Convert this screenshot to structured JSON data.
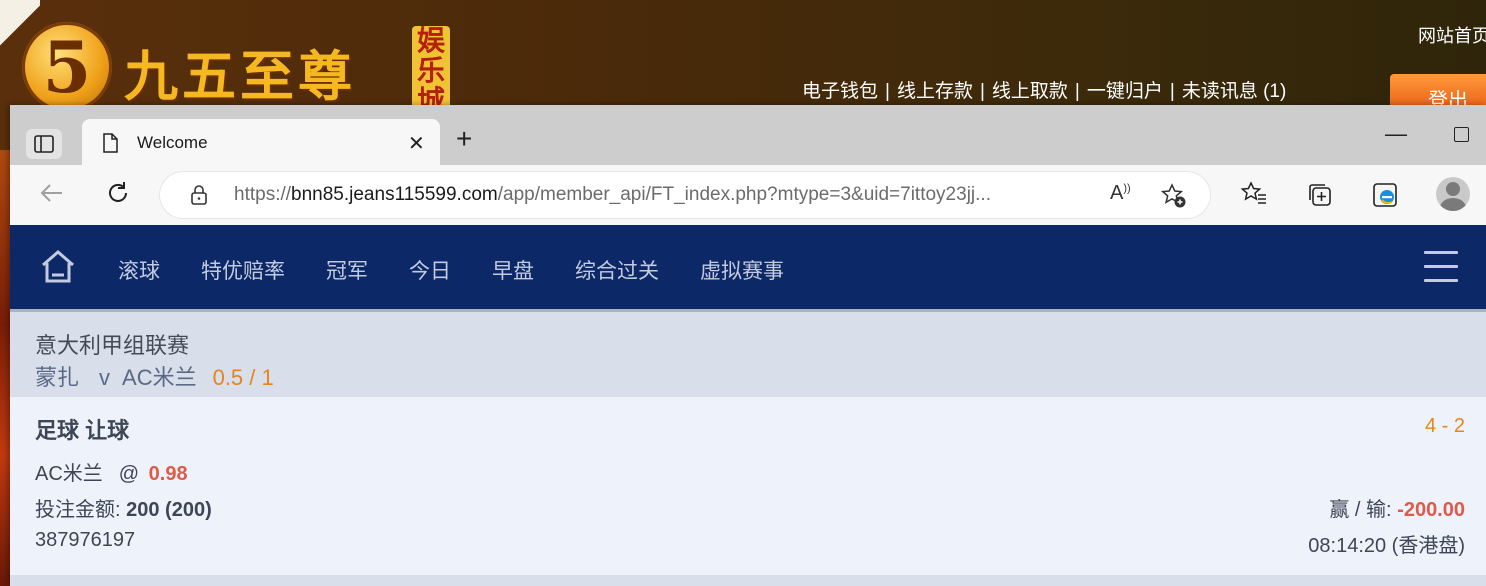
{
  "background_site": {
    "logo_digit": "5",
    "logo_text": "九五至尊",
    "logo_badge": "娱乐城",
    "home_link": "网站首页",
    "top_links": [
      "电子钱包",
      "线上存款",
      "线上取款",
      "一键归户",
      "未读讯息 (1)"
    ],
    "link_separator": "|",
    "logout": "登出"
  },
  "browser": {
    "tab_title": "Welcome",
    "url_prefix": "https://",
    "url_host": "bnn85.jeans115599.com",
    "url_path": "/app/member_api/FT_index.php?mtype=3&uid=7ittoy23jj..."
  },
  "nav": {
    "items": [
      "滚球",
      "特优赔率",
      "冠军",
      "今日",
      "早盘",
      "综合过关",
      "虚拟赛事"
    ]
  },
  "match": {
    "league": "意大利甲组联赛",
    "home_team": "蒙扎",
    "vs": "v",
    "away_team": "AC米兰",
    "handicap": "0.5 / 1"
  },
  "bet": {
    "type": "足球 让球",
    "score": "4 - 2",
    "selection": "AC米兰",
    "at": "@",
    "odds": "0.98",
    "stake_label": "投注金额:",
    "stake_value": "200 (200)",
    "winlose_label": "赢 / 输:",
    "winlose_value": "-200.00",
    "ticket_id": "387976197",
    "time": "08:14:20 (香港盘)"
  },
  "colors": {
    "nav_bg": "#0c2866",
    "accent_orange": "#e8841c",
    "loss_red": "#e05a4a"
  }
}
